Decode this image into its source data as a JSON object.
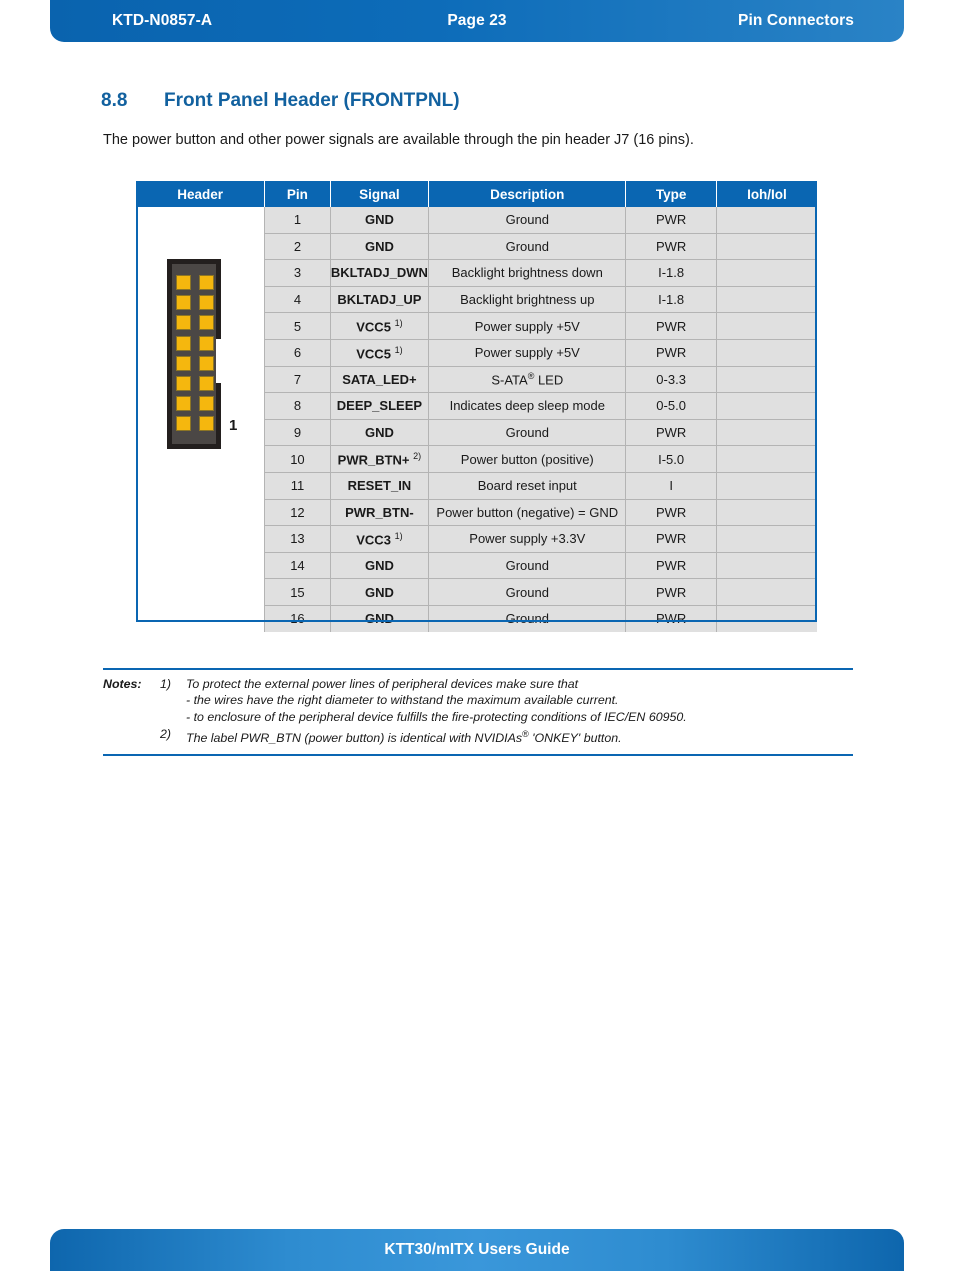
{
  "header": {
    "doc_id": "KTD-N0857-A",
    "page_label": "Page 23",
    "chapter": "Pin Connectors"
  },
  "footer": {
    "title": "KTT30/mITX Users Guide"
  },
  "section": {
    "number": "8.8",
    "title": "Front Panel Header (FRONTPNL)",
    "intro": "The power button and other power signals are available through the pin header J7 (16 pins)."
  },
  "table": {
    "columns": [
      "Header",
      "Pin",
      "Signal",
      "Description",
      "Type",
      "Ioh/Iol"
    ],
    "connector": {
      "pin_count": 16,
      "rows": 8,
      "cols": 2,
      "first_pin_label": "1",
      "body_color": "#4b4745",
      "pad_color": "#f5b70e"
    },
    "rows": [
      {
        "pin": "1",
        "signal": "GND",
        "signal_note": "",
        "description": "Ground",
        "type": "PWR",
        "ioh": ""
      },
      {
        "pin": "2",
        "signal": "GND",
        "signal_note": "",
        "description": "Ground",
        "type": "PWR",
        "ioh": ""
      },
      {
        "pin": "3",
        "signal": "BKLTADJ_DWN",
        "signal_note": "",
        "description": "Backlight brightness down",
        "type": "I-1.8",
        "ioh": ""
      },
      {
        "pin": "4",
        "signal": "BKLTADJ_UP",
        "signal_note": "",
        "description": "Backlight brightness up",
        "type": "I-1.8",
        "ioh": ""
      },
      {
        "pin": "5",
        "signal": "VCC5",
        "signal_note": "1)",
        "description": "Power supply +5V",
        "type": "PWR",
        "ioh": ""
      },
      {
        "pin": "6",
        "signal": "VCC5",
        "signal_note": "1)",
        "description": "Power supply +5V",
        "type": "PWR",
        "ioh": ""
      },
      {
        "pin": "7",
        "signal": "SATA_LED+",
        "signal_note": "",
        "description": "S-ATA® LED",
        "type": "0-3.3",
        "ioh": ""
      },
      {
        "pin": "8",
        "signal": "DEEP_SLEEP",
        "signal_note": "",
        "description": "Indicates deep sleep mode",
        "type": "0-5.0",
        "ioh": ""
      },
      {
        "pin": "9",
        "signal": "GND",
        "signal_note": "",
        "description": "Ground",
        "type": "PWR",
        "ioh": ""
      },
      {
        "pin": "10",
        "signal": "PWR_BTN+",
        "signal_note": "2)",
        "description": "Power button (positive)",
        "type": "I-5.0",
        "ioh": ""
      },
      {
        "pin": "11",
        "signal": "RESET_IN",
        "signal_note": "",
        "description": "Board reset input",
        "type": "I",
        "ioh": ""
      },
      {
        "pin": "12",
        "signal": "PWR_BTN-",
        "signal_note": "",
        "description": "Power button (negative) = GND",
        "type": "PWR",
        "ioh": ""
      },
      {
        "pin": "13",
        "signal": "VCC3",
        "signal_note": "1)",
        "description": "Power supply +3.3V",
        "type": "PWR",
        "ioh": ""
      },
      {
        "pin": "14",
        "signal": "GND",
        "signal_note": "",
        "description": "Ground",
        "type": "PWR",
        "ioh": ""
      },
      {
        "pin": "15",
        "signal": "GND",
        "signal_note": "",
        "description": "Ground",
        "type": "PWR",
        "ioh": ""
      },
      {
        "pin": "16",
        "signal": "GND",
        "signal_note": "",
        "description": "Ground",
        "type": "PWR",
        "ioh": ""
      }
    ]
  },
  "notes": {
    "label": "Notes:",
    "items": [
      {
        "marker": "1)",
        "lines": [
          "To protect the external power lines of peripheral devices make sure that",
          "- the wires have the right diameter to withstand the maximum available current.",
          "- to enclosure of the peripheral device fulfills the fire-protecting conditions of IEC/EN 60950."
        ]
      },
      {
        "marker": "2)",
        "text_before": "The label PWR_BTN (power button) is identical with NVIDIAs",
        "superscript": "®",
        "text_after": " 'ONKEY' button."
      }
    ]
  },
  "colors": {
    "brand_blue": "#0a66b2",
    "heading_blue": "#12619f",
    "cell_gray": "#e0e0e0",
    "pad_gold": "#f5b70e"
  }
}
